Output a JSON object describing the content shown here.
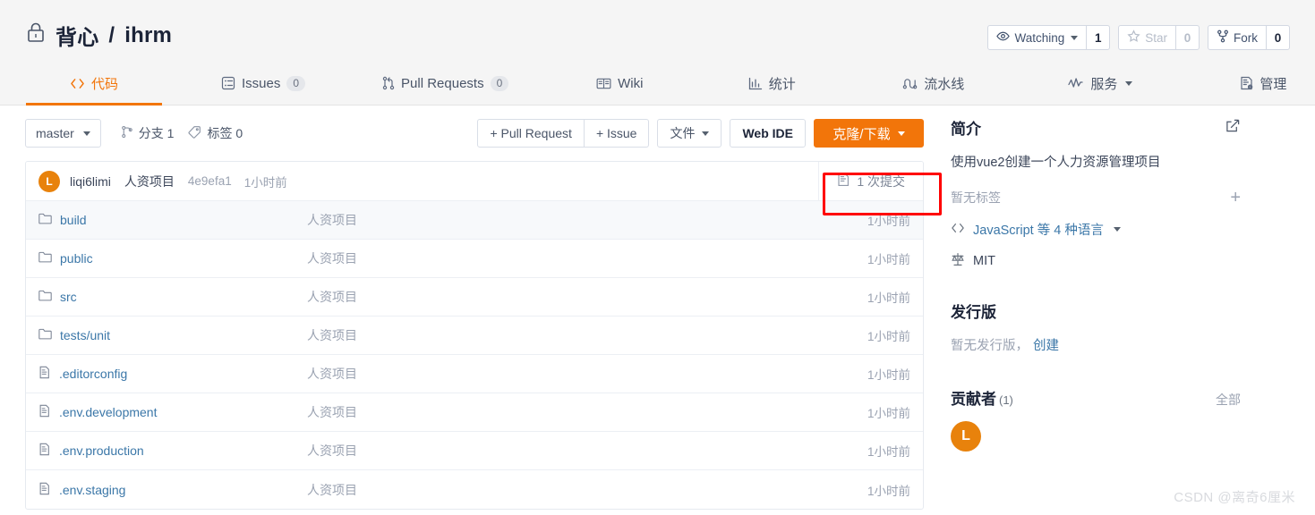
{
  "header": {
    "lock_icon": "lock-icon",
    "owner": "背心",
    "separator": "/",
    "repo": "ihrm",
    "watching_label": "Watching",
    "watching_count": "1",
    "star_label": "Star",
    "star_count": "0",
    "fork_label": "Fork",
    "fork_count": "0"
  },
  "tabs": [
    {
      "label": "代码",
      "icon": "code-icon",
      "badge": "",
      "active": true
    },
    {
      "label": "Issues",
      "icon": "issue-icon",
      "badge": "0",
      "active": false
    },
    {
      "label": "Pull Requests",
      "icon": "pull-request-icon",
      "badge": "0",
      "active": false
    },
    {
      "label": "Wiki",
      "icon": "book-icon",
      "badge": "",
      "active": false
    },
    {
      "label": "统计",
      "icon": "chart-icon",
      "badge": "",
      "active": false
    },
    {
      "label": "流水线",
      "icon": "pipeline-icon",
      "badge": "",
      "active": false
    },
    {
      "label": "服务",
      "icon": "activity-icon",
      "badge": "",
      "active": false
    },
    {
      "label": "管理",
      "icon": "settings-doc-icon",
      "badge": "",
      "active": false
    }
  ],
  "toolbar": {
    "branch": "master",
    "branches_label": "分支 1",
    "tags_label": "标签 0",
    "pull_request_button": "+ Pull Request",
    "issue_button": "+ Issue",
    "files_button": "文件",
    "web_ide_button": "Web IDE",
    "clone_button": "克隆/下载",
    "clone_color": "#f2750a"
  },
  "commit": {
    "avatar_letter": "L",
    "author": "liqi6limi",
    "message": "人资项目",
    "hash": "4e9efa1",
    "time": "1小时前",
    "count_label": "1 次提交",
    "count_icon": "commit-list-icon"
  },
  "files": [
    {
      "name": "build",
      "type": "folder",
      "message": "人资项目",
      "time": "1小时前"
    },
    {
      "name": "public",
      "type": "folder",
      "message": "人资项目",
      "time": "1小时前"
    },
    {
      "name": "src",
      "type": "folder",
      "message": "人资项目",
      "time": "1小时前"
    },
    {
      "name": "tests/unit",
      "type": "folder",
      "message": "人资项目",
      "time": "1小时前"
    },
    {
      "name": ".editorconfig",
      "type": "file",
      "message": "人资项目",
      "time": "1小时前"
    },
    {
      "name": ".env.development",
      "type": "file",
      "message": "人资项目",
      "time": "1小时前"
    },
    {
      "name": ".env.production",
      "type": "file",
      "message": "人资项目",
      "time": "1小时前"
    },
    {
      "name": ".env.staging",
      "type": "file",
      "message": "人资项目",
      "time": "1小时前"
    }
  ],
  "sidebar": {
    "intro_title": "简介",
    "edit_icon": "edit-icon",
    "description": "使用vue2创建一个人力资源管理项目",
    "no_tags": "暂无标签",
    "add_tag": "+",
    "language": "JavaScript 等 4 种语言",
    "license": "MIT",
    "releases_title": "发行版",
    "no_releases": "暂无发行版，",
    "create_release": "创建",
    "contributors_title": "贡献者",
    "contributors_count": "(1)",
    "contributors_all": "全部",
    "contributor_avatars": [
      "L"
    ]
  },
  "annotation": {
    "color": "#ff0000",
    "target": "1 次提交"
  },
  "watermark": "CSDN @离奇6厘米"
}
